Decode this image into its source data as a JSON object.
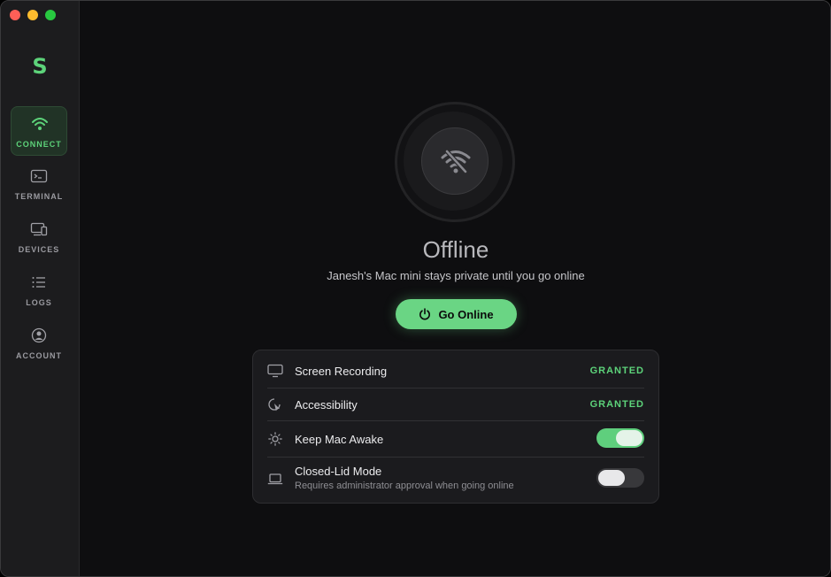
{
  "sidebar": {
    "logo": "S",
    "items": [
      {
        "label": "CONNECT",
        "icon": "wifi-icon",
        "active": true
      },
      {
        "label": "TERMINAL",
        "icon": "terminal-icon",
        "active": false
      },
      {
        "label": "DEVICES",
        "icon": "devices-icon",
        "active": false
      },
      {
        "label": "LOGS",
        "icon": "list-icon",
        "active": false
      },
      {
        "label": "ACCOUNT",
        "icon": "account-icon",
        "active": false
      }
    ]
  },
  "status": {
    "icon": "wifi-off-icon",
    "title": "Offline",
    "subtitle": "Janesh's Mac mini stays private until you go online"
  },
  "go_online": {
    "label": "Go Online",
    "icon": "power-icon"
  },
  "permissions": [
    {
      "label": "Screen Recording",
      "icon": "display-icon",
      "status": "GRANTED"
    },
    {
      "label": "Accessibility",
      "icon": "cursor-icon",
      "status": "GRANTED"
    },
    {
      "label": "Keep Mac Awake",
      "icon": "sun-icon",
      "toggle": true
    },
    {
      "label": "Closed-Lid Mode",
      "sub": "Requires administrator approval when going online",
      "icon": "laptop-icon",
      "toggle": false
    }
  ],
  "colors": {
    "accent": "#5dd37a",
    "background": "#0e0e10",
    "sidebar": "#1c1c1e"
  }
}
